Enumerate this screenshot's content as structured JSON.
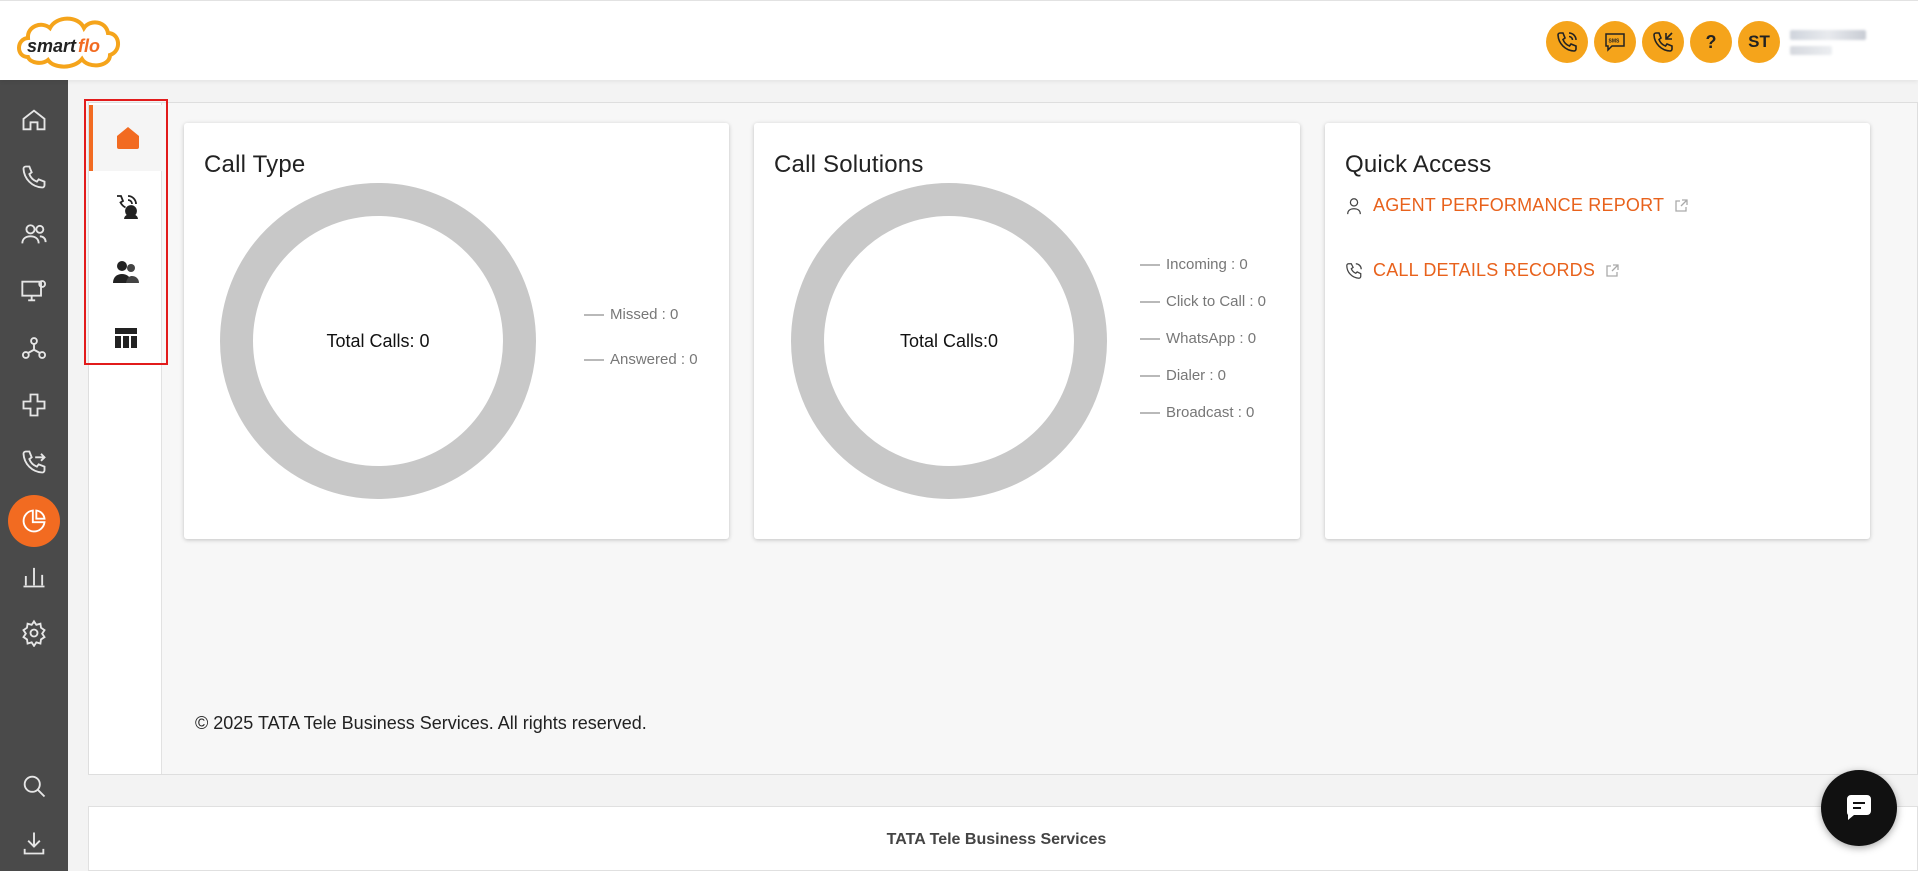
{
  "brand": {
    "logo_text": "smartflo",
    "accent": "#f26b21",
    "topbar_button_color": "#f5a41b"
  },
  "topbar": {
    "buttons": [
      {
        "icon": "phone-call-icon"
      },
      {
        "icon": "sms-icon",
        "label": "SMS"
      },
      {
        "icon": "phone-incoming-icon"
      },
      {
        "icon": "help-icon",
        "label": "?"
      }
    ],
    "avatar_initials": "ST"
  },
  "leftbar": {
    "items": [
      "home-icon",
      "phone-icon",
      "users-icon",
      "monitor-settings-icon",
      "network-icon",
      "integrations-icon",
      "call-routing-icon",
      "analytics-pie-icon",
      "bar-chart-icon",
      "settings-icon",
      "search-icon",
      "download-icon"
    ],
    "active": "analytics-pie-icon"
  },
  "subnav": {
    "items": [
      "home-icon",
      "call-agent-icon",
      "team-icon",
      "table-icon"
    ],
    "active": "home-icon"
  },
  "call_type": {
    "title": "Call Type",
    "center_label": "Total Calls: 0",
    "legend": [
      "Missed : 0",
      "Answered : 0"
    ]
  },
  "call_solutions": {
    "title": "Call Solutions",
    "center_label": "Total Calls:0",
    "legend": [
      "Incoming : 0",
      "Click to Call : 0",
      "WhatsApp : 0",
      "Dialer : 0",
      "Broadcast : 0"
    ]
  },
  "quick_access": {
    "title": "Quick Access",
    "links": [
      {
        "label": "AGENT PERFORMANCE REPORT",
        "icon": "user-icon"
      },
      {
        "label": "CALL DETAILS RECORDS",
        "icon": "phone-icon"
      }
    ]
  },
  "footer": {
    "copyright": "© 2025 TATA Tele Business Services. All rights reserved.",
    "company": "TATA Tele Business Services"
  }
}
